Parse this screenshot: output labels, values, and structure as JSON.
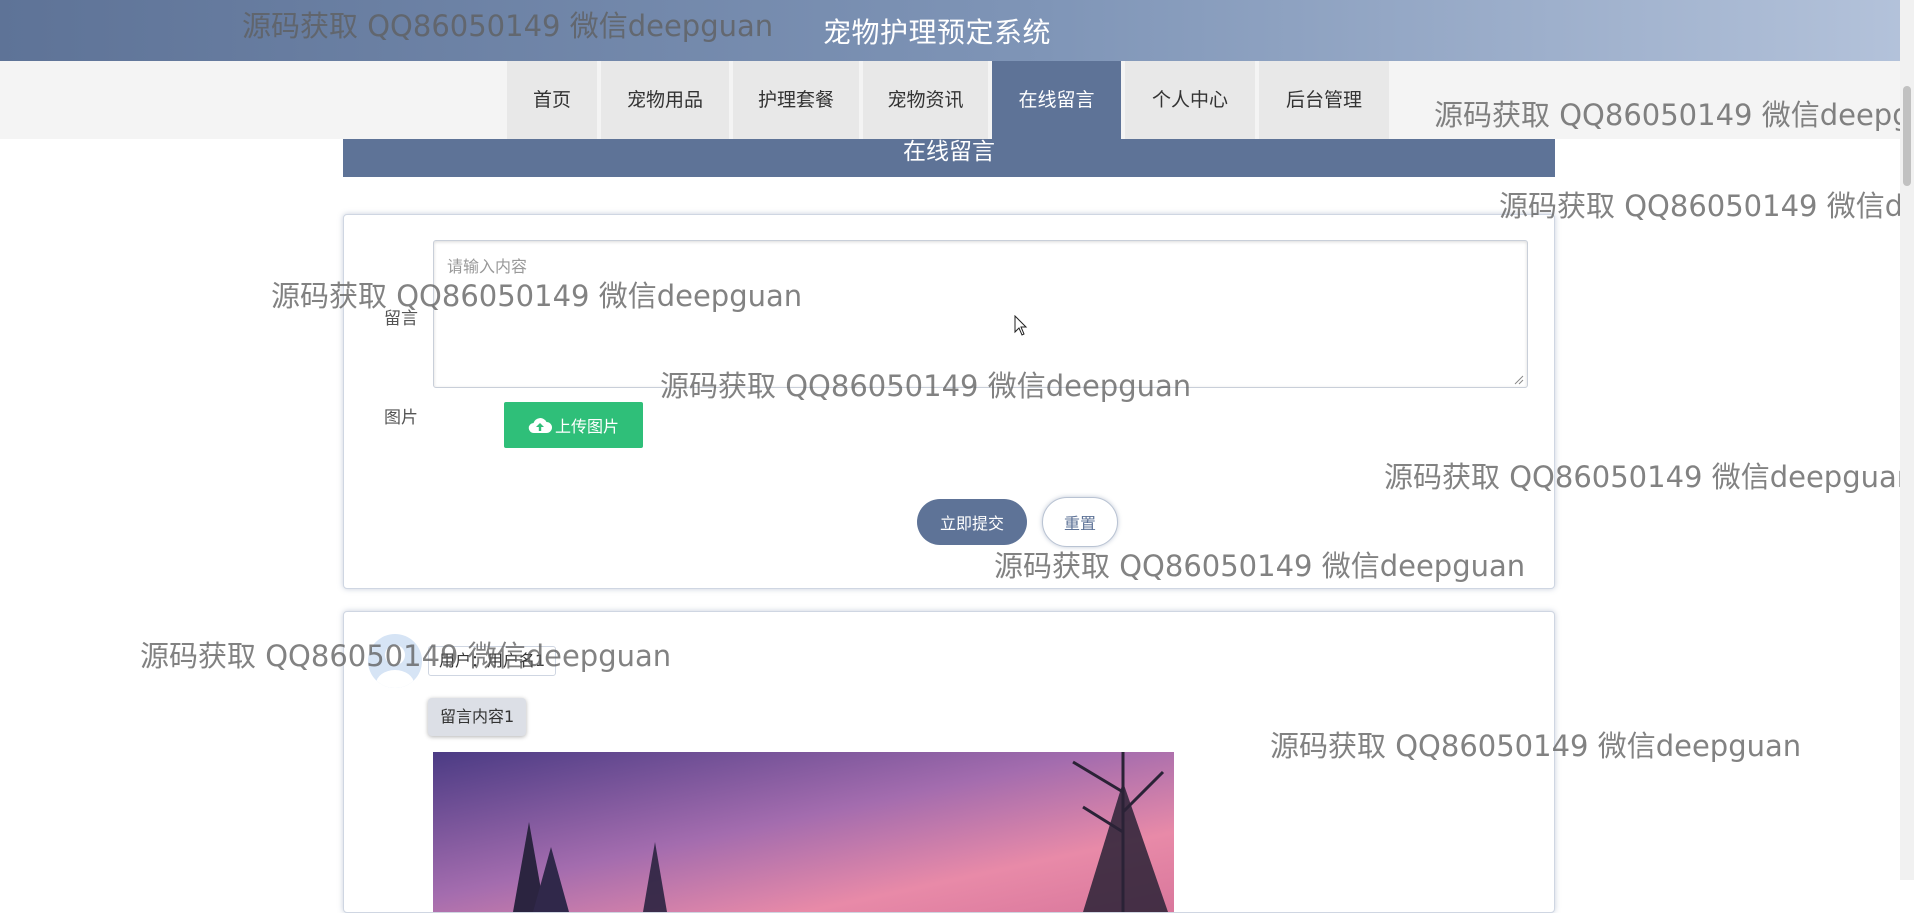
{
  "header": {
    "site_title": "宠物护理预定系统"
  },
  "nav": {
    "items": [
      {
        "label": "首页",
        "active": false
      },
      {
        "label": "宠物用品",
        "active": false
      },
      {
        "label": "护理套餐",
        "active": false
      },
      {
        "label": "宠物资讯",
        "active": false
      },
      {
        "label": "在线留言",
        "active": true
      },
      {
        "label": "个人中心",
        "active": false
      },
      {
        "label": "后台管理",
        "active": false
      }
    ]
  },
  "section": {
    "title": "在线留言"
  },
  "form": {
    "message_label": "留言",
    "message_placeholder": "请输入内容",
    "image_label": "图片",
    "upload_label": "上传图片",
    "submit_label": "立即提交",
    "reset_label": "重置"
  },
  "messages": [
    {
      "user": "用户：用户名1",
      "content": "留言内容1"
    }
  ],
  "watermark_text": "源码获取 QQ86050149 微信deepguan",
  "colors": {
    "theme": "#5e7397",
    "upload": "#2fbf79",
    "nav_bg": "#e8e8e8"
  }
}
